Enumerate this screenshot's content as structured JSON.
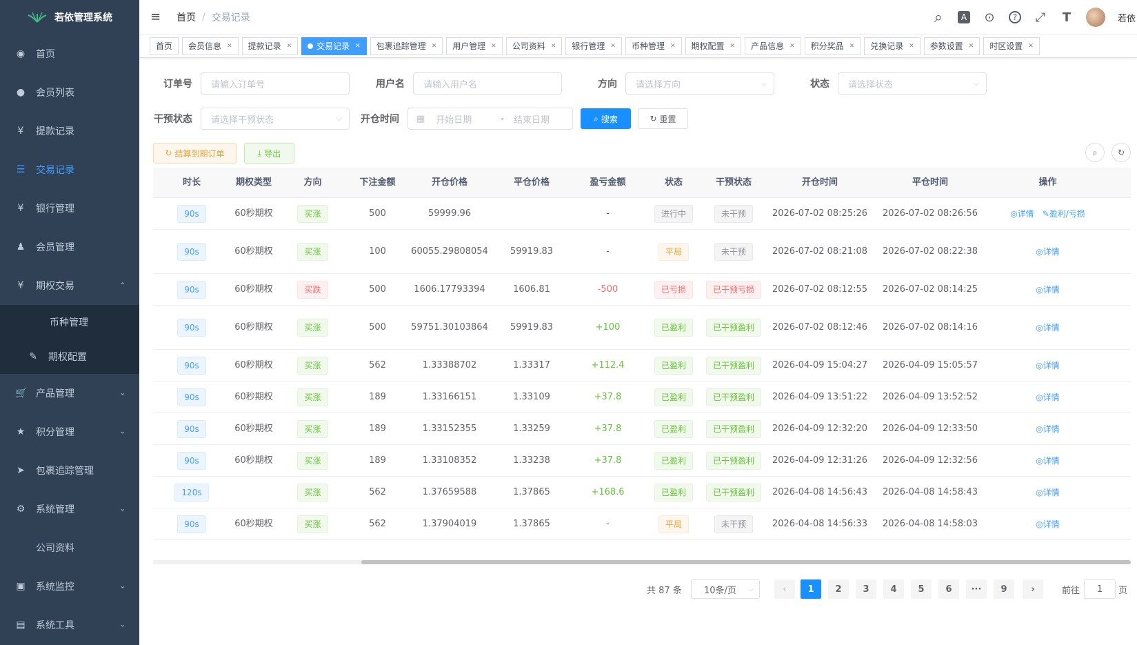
{
  "app": {
    "title": "若依管理系统"
  },
  "sidebar": {
    "items": [
      {
        "label": "首页",
        "icon": "dashboard-icon",
        "glyph": "◉"
      },
      {
        "label": "会员列表",
        "icon": "user-icon",
        "glyph": "●"
      },
      {
        "label": "提款记录",
        "icon": "yen-icon",
        "glyph": "¥"
      },
      {
        "label": "交易记录",
        "icon": "list-icon",
        "glyph": "☰"
      },
      {
        "label": "银行管理",
        "icon": "yen-icon",
        "glyph": "¥"
      },
      {
        "label": "会员管理",
        "icon": "people-icon",
        "glyph": "♟"
      },
      {
        "label": "期权交易",
        "icon": "yen-icon",
        "glyph": "¥"
      },
      {
        "label": "币种管理"
      },
      {
        "label": "期权配置",
        "icon": "edit-icon",
        "glyph": "✎"
      },
      {
        "label": "产品管理",
        "icon": "cart-icon",
        "glyph": "🛒"
      },
      {
        "label": "积分管理",
        "icon": "star-icon",
        "glyph": "★"
      },
      {
        "label": "包裹追踪管理",
        "icon": "send-icon",
        "glyph": "➤"
      },
      {
        "label": "系统管理",
        "icon": "gear-icon",
        "glyph": "⚙"
      },
      {
        "label": "公司资料"
      },
      {
        "label": "系统监控",
        "icon": "monitor-icon",
        "glyph": "▣"
      },
      {
        "label": "系统工具",
        "icon": "toolbox-icon",
        "glyph": "▤"
      }
    ]
  },
  "navbar": {
    "breadcrumb_home": "首页",
    "breadcrumb_sep": "/",
    "breadcrumb_current": "交易记录",
    "username": "若依",
    "icons": {
      "hamburger": "≡",
      "search": "⌕",
      "translate": "A",
      "github": "⊙",
      "help": "?",
      "fullscreen": "⤢",
      "font_size": "T"
    }
  },
  "tags": [
    {
      "label": "首页",
      "closable": false,
      "active": false
    },
    {
      "label": "会员信息",
      "closable": true,
      "active": false
    },
    {
      "label": "提款记录",
      "closable": true,
      "active": false
    },
    {
      "label": "交易记录",
      "closable": true,
      "active": true
    },
    {
      "label": "包裹追踪管理",
      "closable": true,
      "active": false
    },
    {
      "label": "用户管理",
      "closable": true,
      "active": false
    },
    {
      "label": "公司资料",
      "closable": true,
      "active": false
    },
    {
      "label": "银行管理",
      "closable": true,
      "active": false
    },
    {
      "label": "币种管理",
      "closable": true,
      "active": false
    },
    {
      "label": "期权配置",
      "closable": true,
      "active": false
    },
    {
      "label": "产品信息",
      "closable": true,
      "active": false
    },
    {
      "label": "积分奖品",
      "closable": true,
      "active": false
    },
    {
      "label": "兑换记录",
      "closable": true,
      "active": false
    },
    {
      "label": "参数设置",
      "closable": true,
      "active": false
    },
    {
      "label": "时区设置",
      "closable": true,
      "active": false
    }
  ],
  "filters": {
    "order_no": {
      "label": "订单号",
      "placeholder": "请输入订单号"
    },
    "username": {
      "label": "用户名",
      "placeholder": "请输入用户名"
    },
    "direction": {
      "label": "方向",
      "placeholder": "请选择方向"
    },
    "status": {
      "label": "状态",
      "placeholder": "请选择状态"
    },
    "intervene": {
      "label": "干预状态",
      "placeholder": "请选择干预状态"
    },
    "open_time": {
      "label": "开仓时间",
      "start": "开始日期",
      "sep": "-",
      "end": "结束日期"
    },
    "search_btn": "搜索",
    "reset_btn": "重置"
  },
  "toolbar": {
    "settle_btn": "结算到期订单",
    "export_btn": "导出"
  },
  "table": {
    "headers": [
      "时长",
      "期权类型",
      "方向",
      "下注金额",
      "开仓价格",
      "平仓价格",
      "盈亏金额",
      "状态",
      "干预状态",
      "开仓时间",
      "平仓时间",
      "操作"
    ],
    "detail_label": "详情",
    "profit_loss_label": "盈利/亏损",
    "rows": [
      {
        "duration": "90s",
        "type": "60秒期权",
        "direction": "买涨",
        "dir_tone": "green",
        "amount": "500",
        "open_price": "59999.96",
        "close_price": "",
        "pnl": "-",
        "pnl_tone": "",
        "status": "进行中",
        "status_tone": "gray",
        "intervene": "未干预",
        "int_tone": "gray",
        "open_time": "2026-07-02 08:25:26",
        "close_time": "2026-07-02 08:26:56",
        "ops": 2,
        "h": 46
      },
      {
        "duration": "90s",
        "type": "60秒期权",
        "direction": "买涨",
        "dir_tone": "green",
        "amount": "100",
        "open_price": "60055.29808054",
        "close_price": "59919.83",
        "pnl": "-",
        "pnl_tone": "",
        "status": "平局",
        "status_tone": "orange",
        "intervene": "未干预",
        "int_tone": "gray",
        "open_time": "2026-07-02 08:21:08",
        "close_time": "2026-07-02 08:22:38",
        "ops": 1,
        "h": 64
      },
      {
        "duration": "90s",
        "type": "60秒期权",
        "direction": "买跌",
        "dir_tone": "red",
        "amount": "500",
        "open_price": "1606.17793394",
        "close_price": "1606.81",
        "pnl": "-500",
        "pnl_tone": "red",
        "status": "已亏损",
        "status_tone": "red",
        "intervene": "已干预亏损",
        "int_tone": "red",
        "open_time": "2026-07-02 08:12:55",
        "close_time": "2026-07-02 08:14:25",
        "ops": 1,
        "h": 46
      },
      {
        "duration": "90s",
        "type": "60秒期权",
        "direction": "买涨",
        "dir_tone": "green",
        "amount": "500",
        "open_price": "59751.30103864",
        "close_price": "59919.83",
        "pnl": "+100",
        "pnl_tone": "green",
        "status": "已盈利",
        "status_tone": "green",
        "intervene": "已干预盈利",
        "int_tone": "green",
        "open_time": "2026-07-02 08:12:46",
        "close_time": "2026-07-02 08:14:16",
        "ops": 1,
        "h": 64
      },
      {
        "duration": "90s",
        "type": "60秒期权",
        "direction": "买涨",
        "dir_tone": "green",
        "amount": "562",
        "open_price": "1.33388702",
        "close_price": "1.33317",
        "pnl": "+112.4",
        "pnl_tone": "green",
        "status": "已盈利",
        "status_tone": "green",
        "intervene": "已干预盈利",
        "int_tone": "green",
        "open_time": "2026-04-09 15:04:27",
        "close_time": "2026-04-09 15:05:57",
        "ops": 1,
        "h": 46
      },
      {
        "duration": "90s",
        "type": "60秒期权",
        "direction": "买涨",
        "dir_tone": "green",
        "amount": "189",
        "open_price": "1.33166151",
        "close_price": "1.33109",
        "pnl": "+37.8",
        "pnl_tone": "green",
        "status": "已盈利",
        "status_tone": "green",
        "intervene": "已干预盈利",
        "int_tone": "green",
        "open_time": "2026-04-09 13:51:22",
        "close_time": "2026-04-09 13:52:52",
        "ops": 1,
        "h": 46
      },
      {
        "duration": "90s",
        "type": "60秒期权",
        "direction": "买涨",
        "dir_tone": "green",
        "amount": "189",
        "open_price": "1.33152355",
        "close_price": "1.33259",
        "pnl": "+37.8",
        "pnl_tone": "green",
        "status": "已盈利",
        "status_tone": "green",
        "intervene": "已干预盈利",
        "int_tone": "green",
        "open_time": "2026-04-09 12:32:20",
        "close_time": "2026-04-09 12:33:50",
        "ops": 1,
        "h": 46
      },
      {
        "duration": "90s",
        "type": "60秒期权",
        "direction": "买涨",
        "dir_tone": "green",
        "amount": "189",
        "open_price": "1.33108352",
        "close_price": "1.33238",
        "pnl": "+37.8",
        "pnl_tone": "green",
        "status": "已盈利",
        "status_tone": "green",
        "intervene": "已干预盈利",
        "int_tone": "green",
        "open_time": "2026-04-09 12:31:26",
        "close_time": "2026-04-09 12:32:56",
        "ops": 1,
        "h": 46
      },
      {
        "duration": "120s",
        "type": "",
        "direction": "买涨",
        "dir_tone": "green",
        "amount": "562",
        "open_price": "1.37659588",
        "close_price": "1.37865",
        "pnl": "+168.6",
        "pnl_tone": "green",
        "status": "已盈利",
        "status_tone": "green",
        "intervene": "已干预盈利",
        "int_tone": "green",
        "open_time": "2026-04-08 14:56:43",
        "close_time": "2026-04-08 14:58:43",
        "ops": 1,
        "h": 46
      },
      {
        "duration": "90s",
        "type": "60秒期权",
        "direction": "买涨",
        "dir_tone": "green",
        "amount": "562",
        "open_price": "1.37904019",
        "close_price": "1.37865",
        "pnl": "-",
        "pnl_tone": "",
        "status": "平局",
        "status_tone": "orange",
        "intervene": "未干预",
        "int_tone": "gray",
        "open_time": "2026-04-08 14:56:33",
        "close_time": "2026-04-08 14:58:03",
        "ops": 1,
        "h": 46
      }
    ]
  },
  "pagination": {
    "total_text": "共 87 条",
    "page_size": "10条/页",
    "prev": "‹",
    "next": "›",
    "pages": [
      "1",
      "2",
      "3",
      "4",
      "5",
      "6",
      "···",
      "9"
    ],
    "current": "1",
    "goto_label": "前往",
    "goto_value": "1",
    "page_suffix": "页"
  },
  "colors": {
    "sidebar_bg": "#304156",
    "sidebar_active": "#409eff",
    "primary": "#1890ff"
  }
}
